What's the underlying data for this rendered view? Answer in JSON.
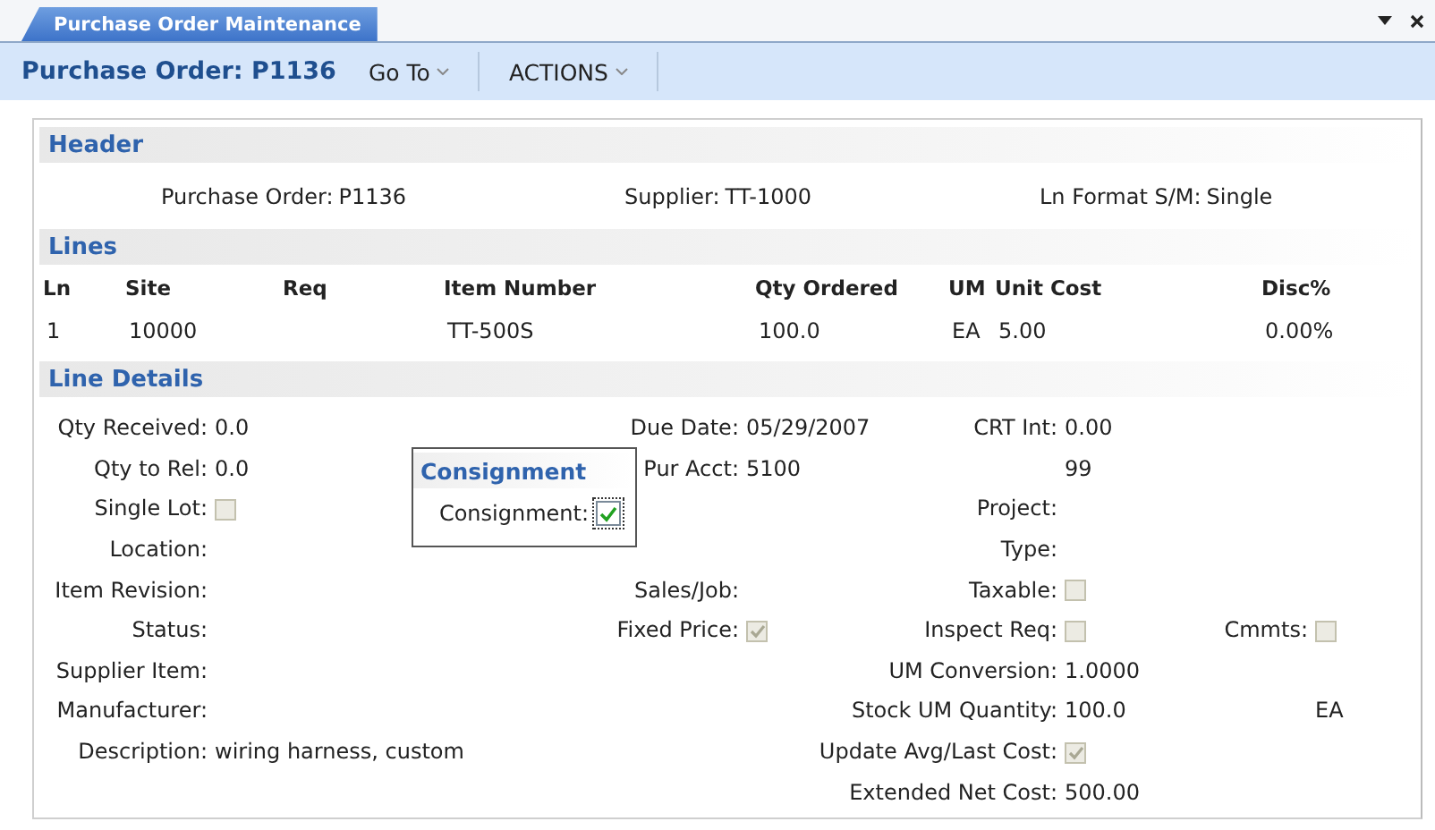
{
  "tab": {
    "label": "Purchase Order Maintenance",
    "selected": true
  },
  "toolbar": {
    "title": "Purchase Order: P1136",
    "menus": [
      {
        "label": "Go To"
      },
      {
        "label": "ACTIONS"
      }
    ]
  },
  "header": {
    "title": "Header",
    "fields": [
      {
        "label": "Purchase Order:",
        "value": "P1136"
      },
      {
        "label": "Supplier:",
        "value": "TT-1000"
      },
      {
        "label": "Ln Format S/M:",
        "value": "Single"
      }
    ]
  },
  "lines": {
    "title": "Lines",
    "columns": [
      "Ln",
      "Site",
      "Req",
      "Item Number",
      "Qty Ordered",
      "UM",
      "Unit Cost",
      "Disc%"
    ],
    "rows": [
      [
        "1",
        "10000",
        "",
        "TT-500S",
        "100.0",
        "EA",
        "5.00",
        "0.00%"
      ]
    ]
  },
  "line_details": {
    "title": "Line Details",
    "rows": [
      [
        {
          "kind": "text",
          "label": "Qty Received:",
          "value": "0.0"
        },
        {
          "kind": "text",
          "label": "Due Date:",
          "value": "05/29/2007"
        },
        {
          "kind": "text",
          "label": "CRT Int:",
          "value": "0.00"
        },
        ""
      ],
      [
        {
          "kind": "text",
          "label": "Qty to Rel:",
          "value": "0.0"
        },
        {
          "kind": "text",
          "label": "Pur Acct:",
          "value": "5100"
        },
        {
          "kind": "text",
          "value": "99"
        },
        ""
      ],
      [
        {
          "kind": "checkbox",
          "label": "Single Lot:",
          "checked": false,
          "disabled": true
        },
        "",
        {
          "kind": "text",
          "label": "Project:"
        },
        ""
      ],
      [
        {
          "kind": "text",
          "label": "Location:"
        },
        "",
        {
          "kind": "text",
          "label": "Type:"
        },
        ""
      ],
      [
        {
          "kind": "text",
          "label": "Item Revision:"
        },
        {
          "kind": "text",
          "label": "Sales/Job:"
        },
        {
          "kind": "checkbox",
          "label": "Taxable:",
          "checked": false,
          "disabled": true
        },
        ""
      ],
      [
        {
          "kind": "text",
          "label": "Status:"
        },
        {
          "kind": "checkbox",
          "label": "Fixed Price:",
          "checked": true,
          "disabled": true
        },
        {
          "kind": "checkbox",
          "label": "Inspect Req:",
          "checked": false,
          "disabled": true
        },
        {
          "kind": "checkbox",
          "label": "Cmmts:",
          "checked": false,
          "disabled": true
        }
      ],
      [
        {
          "kind": "text",
          "label": "Supplier Item:"
        },
        "",
        {
          "kind": "text",
          "label": "UM Conversion:",
          "value": "1.0000"
        },
        ""
      ],
      [
        {
          "kind": "text",
          "label": "Manufacturer:"
        },
        "",
        {
          "kind": "text",
          "label": "Stock UM Quantity:",
          "value": "100.0"
        },
        {
          "kind": "text",
          "value": "EA"
        }
      ],
      [
        {
          "kind": "text",
          "label": "Description:",
          "value": "wiring harness, custom"
        },
        "",
        {
          "kind": "checkbox",
          "label": "Update Avg/Last Cost:",
          "checked": true,
          "disabled": true
        },
        ""
      ],
      [
        "",
        "",
        {
          "kind": "text",
          "label": "Extended Net Cost:",
          "value": "500.00"
        },
        ""
      ]
    ]
  },
  "consignment_popup": {
    "title": "Consignment",
    "label": "Consignment:",
    "checked": true,
    "disabled": false
  }
}
